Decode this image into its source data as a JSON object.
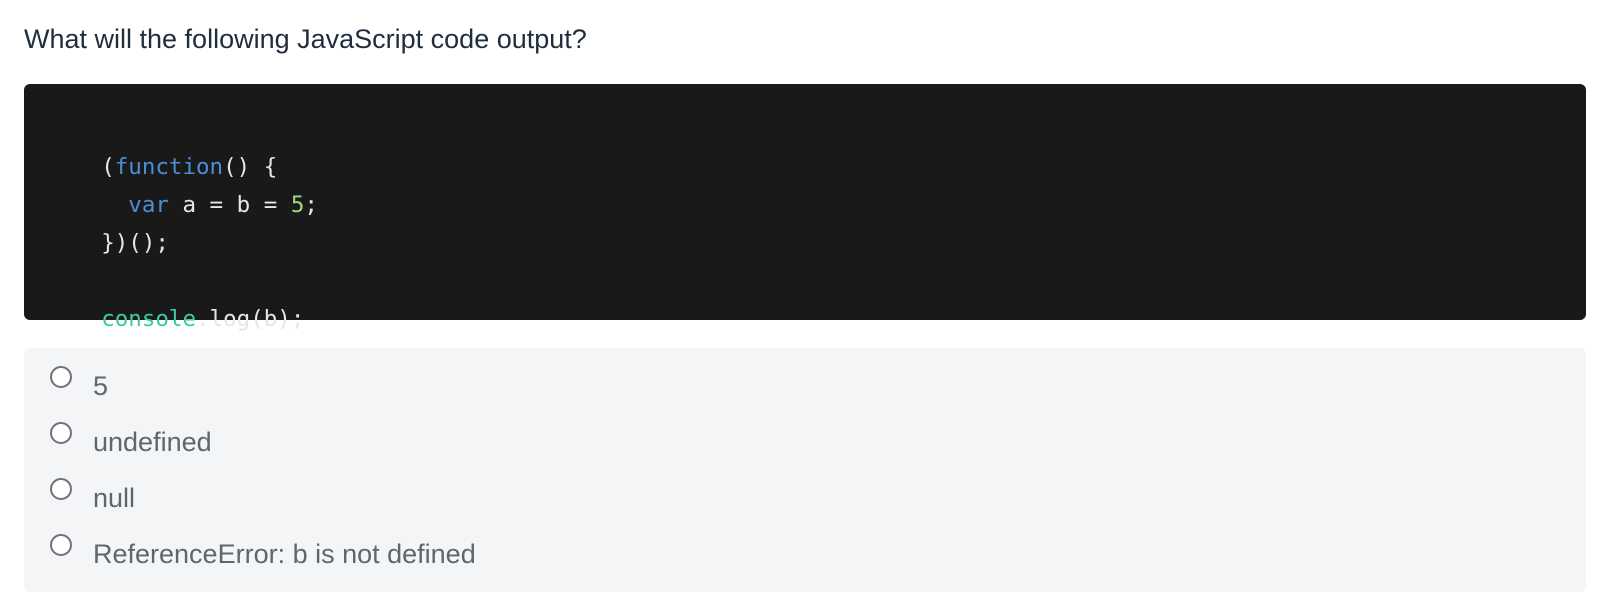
{
  "question": {
    "text": "What will the following JavaScript code output?"
  },
  "code": {
    "language": "JavaScript",
    "lines": [
      [
        {
          "text": "(",
          "kind": "punct"
        },
        {
          "text": "function",
          "kind": "keyword"
        },
        {
          "text": "() {",
          "kind": "punct"
        }
      ],
      [
        {
          "text": "  ",
          "kind": "plain"
        },
        {
          "text": "var",
          "kind": "keyword"
        },
        {
          "text": " a = b = ",
          "kind": "plain"
        },
        {
          "text": "5",
          "kind": "number"
        },
        {
          "text": ";",
          "kind": "punct"
        }
      ],
      [
        {
          "text": "})();",
          "kind": "punct"
        }
      ],
      [],
      [
        {
          "text": "console",
          "kind": "object"
        },
        {
          "text": ".log(b);",
          "kind": "plain"
        }
      ]
    ],
    "colors": {
      "background": "#191919",
      "plain": "#e6e6e6",
      "keyword": "#4b8fd6",
      "number": "#a6d77e",
      "object": "#3ec9a8"
    }
  },
  "options": [
    {
      "label": "5",
      "selected": false
    },
    {
      "label": "undefined",
      "selected": false
    },
    {
      "label": "null",
      "selected": false
    },
    {
      "label": "ReferenceError: b is not defined",
      "selected": false
    }
  ],
  "icons": {
    "radio": "radio-unchecked-icon"
  }
}
